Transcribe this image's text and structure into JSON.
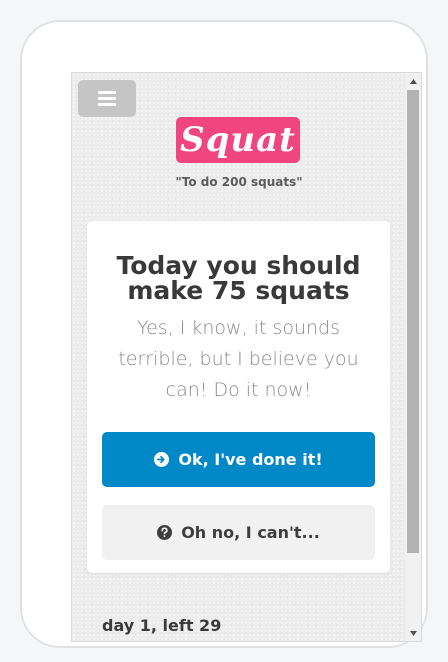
{
  "header": {
    "menu_icon": "hamburger-menu-icon",
    "logo_text": "Squat",
    "tagline": "\"To do 200 squats\""
  },
  "card": {
    "title": "Today you should make 75 squats",
    "message": "Yes, I know, it sounds terrible, but I believe you can! Do it now!",
    "done_button": {
      "label": "Ok, I've done it!",
      "icon": "arrow-circle-right-icon"
    },
    "cant_button": {
      "label": "Oh no, I can't...",
      "icon": "question-circle-icon"
    }
  },
  "progress": {
    "text": "day 1, left 29"
  },
  "colors": {
    "brand": "#f0457e",
    "primary_button": "#0189c7",
    "secondary_button": "#f1f1f1"
  }
}
